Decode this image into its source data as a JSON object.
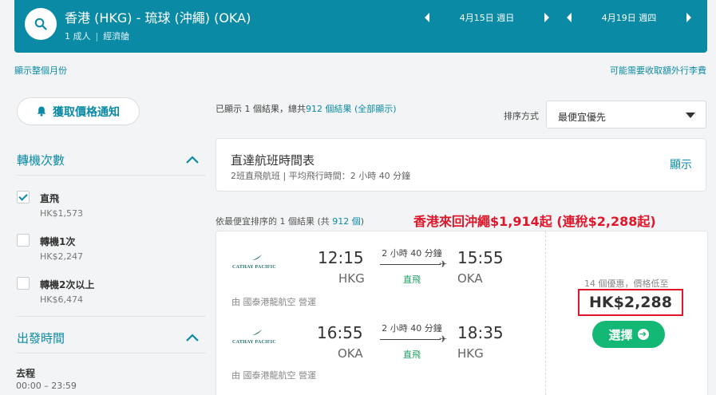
{
  "header": {
    "route": "香港 (HKG) - 琉球 (沖繩) (OKA)",
    "passengers": "1 成人",
    "cabin": "經濟艙",
    "depart_date": "4月15日 週日",
    "return_date": "4月19日 週四",
    "accent_color": "#0b8aa6"
  },
  "links": {
    "whole_month": "顯示整個月份",
    "baggage_fee": "可能需要收取額外行李費"
  },
  "sidebar": {
    "price_alert_label": "獲取價格通知",
    "stops_title": "轉機次數",
    "stops": [
      {
        "label": "直飛",
        "price": "HK$1,573",
        "checked": true
      },
      {
        "label": "轉機1次",
        "price": "HK$2,247",
        "checked": false
      },
      {
        "label": "轉機2次以上",
        "price": "HK$6,474",
        "checked": false
      }
    ],
    "depart_time_title": "出發時間",
    "outbound_label": "去程",
    "outbound_range": "00:00 – 23:59"
  },
  "results": {
    "shown_prefix": "已顯示 1 個結果，總共",
    "total": "912 個結果",
    "all_results": "(全部顯示)",
    "sort_label": "排序方式",
    "sort_value": "最便宜優先",
    "timetable_title": "直達航班時間表",
    "timetable_sub": "2班直飛航班 | 平均飛行時間：2 小時 40 分鐘",
    "timetable_show": "顯示",
    "sorted_prefix": "依最便宜排序的 1 個結果 (共",
    "sorted_total": "912 個",
    "sorted_suffix": ")",
    "promo": "香港來回沖繩$1,914起 (連稅$2,288起)"
  },
  "flight": {
    "airline_logo_text": "CATHAY PACIFIC",
    "legs": [
      {
        "dep_time": "12:15",
        "dep_apt": "HKG",
        "arr_time": "15:55",
        "arr_apt": "OKA",
        "duration": "2 小時 40 分鐘",
        "stops": "直飛",
        "operated": "由 國泰港龍航空 營運"
      },
      {
        "dep_time": "16:55",
        "dep_apt": "OKA",
        "arr_time": "18:35",
        "arr_apt": "HKG",
        "duration": "2 小時 40 分鐘",
        "stops": "直飛",
        "operated": "由 國泰港龍航空 營運"
      }
    ],
    "deals": "14 個優惠，價格低至",
    "price": "HK$2,288",
    "select_label": "選擇"
  }
}
